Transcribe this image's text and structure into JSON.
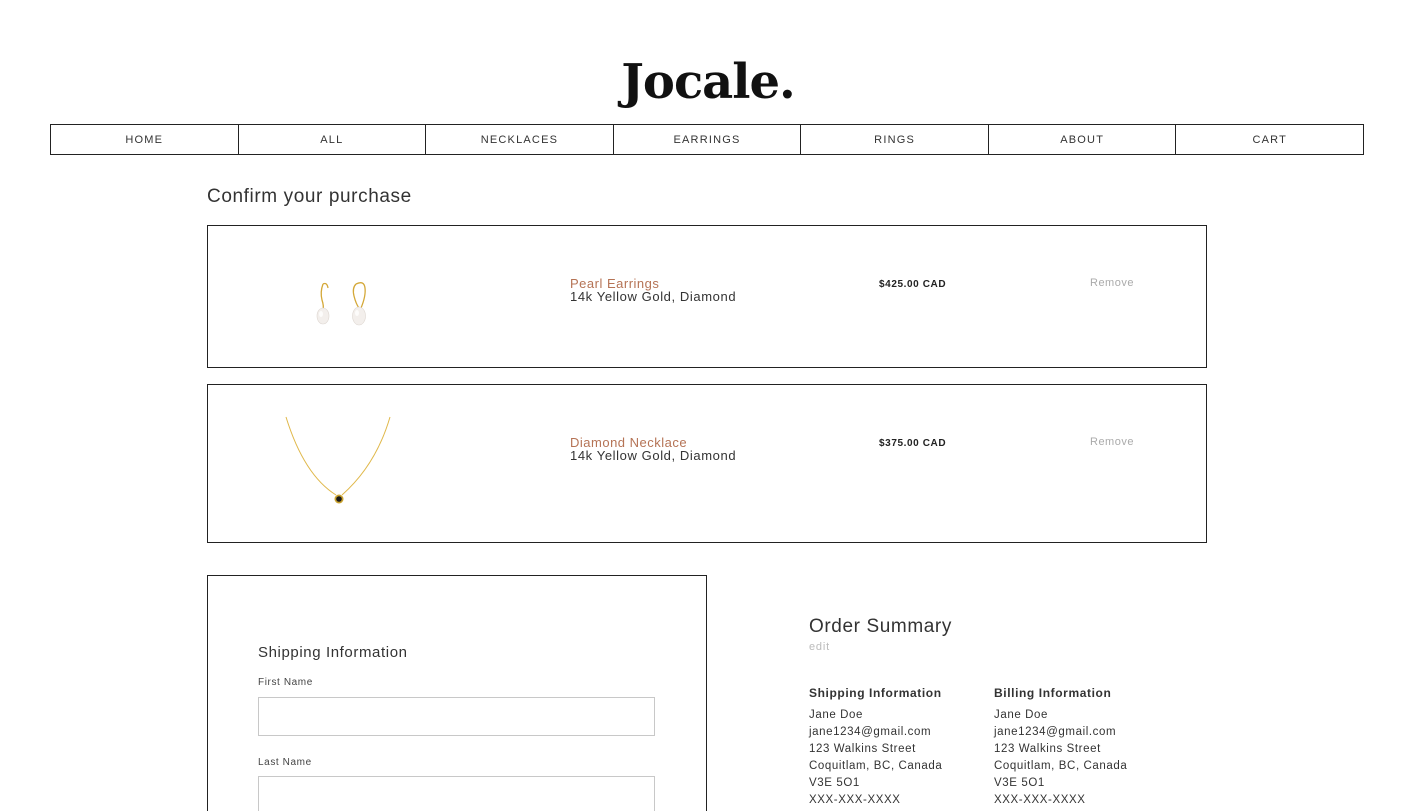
{
  "brand": {
    "logo_text": "Jocale."
  },
  "nav": {
    "items": [
      {
        "label": "HOME"
      },
      {
        "label": "ALL"
      },
      {
        "label": "NECKLACES"
      },
      {
        "label": "EARRINGS"
      },
      {
        "label": "RINGS"
      },
      {
        "label": "ABOUT"
      },
      {
        "label": "CART"
      }
    ]
  },
  "page": {
    "title": "Confirm your purchase"
  },
  "cart": {
    "items": [
      {
        "name": "Pearl Earrings",
        "variant": "14k Yellow Gold, Diamond",
        "price": "$425.00 CAD",
        "remove_label": "Remove",
        "image_icon": "pearl-earrings-image"
      },
      {
        "name": "Diamond Necklace",
        "variant": "14k Yellow Gold, Diamond",
        "price": "$375.00 CAD",
        "remove_label": "Remove",
        "image_icon": "diamond-necklace-image"
      }
    ]
  },
  "shipping_form": {
    "heading": "Shipping Information",
    "fields": [
      {
        "label": "First Name",
        "value": "",
        "placeholder": ""
      },
      {
        "label": "Last Name",
        "value": "",
        "placeholder": ""
      }
    ]
  },
  "summary": {
    "title": "Order Summary",
    "edit_label": "edit",
    "shipping": {
      "heading": "Shipping Information",
      "lines": [
        "Jane Doe",
        "jane1234@gmail.com",
        "123 Walkins Street",
        "Coquitlam, BC, Canada",
        "V3E 5O1",
        "XXX-XXX-XXXX"
      ]
    },
    "billing": {
      "heading": "Billing Information",
      "lines": [
        "Jane Doe",
        "jane1234@gmail.com",
        "123 Walkins Street",
        "Coquitlam, BC, Canada",
        "V3E 5O1",
        "XXX-XXX-XXXX"
      ]
    }
  },
  "colors": {
    "accent": "#b57355",
    "border": "#222222",
    "muted": "#aaaaaa"
  }
}
